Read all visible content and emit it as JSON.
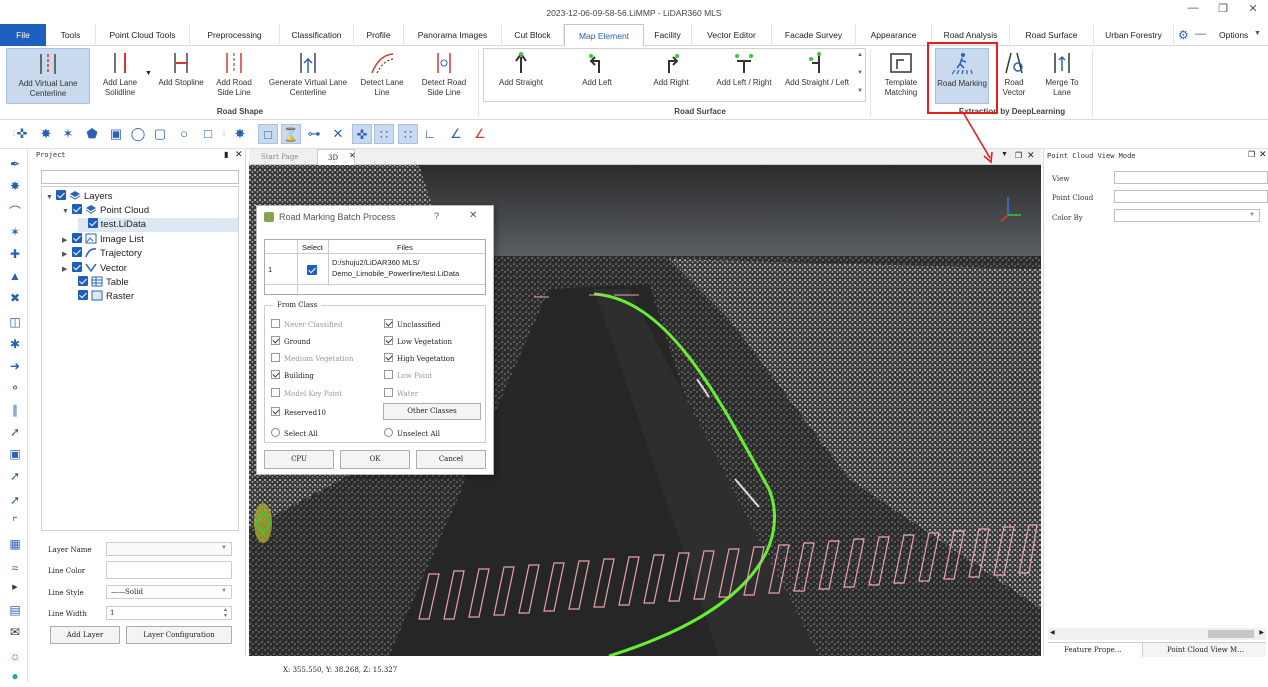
{
  "window": {
    "title": "2023-12-06-09-58-56.LiMMP - LiDAR360 MLS"
  },
  "menu": [
    "File",
    "Tools",
    "Point Cloud Tools",
    "Preprocessing",
    "Classification",
    "Profile",
    "Panorama Images",
    "Cut Block",
    "Map Element",
    "Facility",
    "Vector Editor",
    "Facade Survey",
    "Appearance",
    "Road Analysis",
    "Road Surface",
    "Urban Forestry"
  ],
  "menu_active": "Map Element",
  "options_label": "Options",
  "ribbon": {
    "road_shape": {
      "label": "Road Shape",
      "buttons": [
        "Add Virtual Lane Centerline",
        "Add Lane Solidline",
        "Add Stopline",
        "Add Road Side Line",
        "Generate Virtual Lane Centerline",
        "Detect Lane Line",
        "Detect Road Side Line"
      ]
    },
    "road_surface": {
      "label": "Road Surface",
      "buttons": [
        "Add Straight",
        "Add Left",
        "Add Right",
        "Add Left / Right",
        "Add Straight / Left"
      ]
    },
    "deeplearning": {
      "label": "Extraction by DeepLearning",
      "buttons": [
        "Template Matching",
        "Road Marking",
        "Road Vector",
        "Merge To Lane"
      ]
    }
  },
  "project_panel": {
    "title": "Project",
    "tree": [
      "Layers",
      "Point Cloud",
      "test.LiData",
      "Image List",
      "Trajectory",
      "Vector",
      "Table",
      "Raster"
    ],
    "props": {
      "layer_name_label": "Layer Name",
      "line_color_label": "Line Color",
      "line_style_label": "Line Style",
      "line_style_value": "Solid",
      "line_width_label": "Line Width",
      "line_width_value": "1"
    },
    "add_layer": "Add Layer",
    "layer_config": "Layer Configuration"
  },
  "view_tabs": [
    "Start Page",
    "3D"
  ],
  "right_panel": {
    "title": "Point Cloud View Mode",
    "labels": [
      "View",
      "Point Cloud",
      "Color By"
    ],
    "bottom_tabs": [
      "Feature Propе…",
      "Point Cloud View M…"
    ]
  },
  "dialog": {
    "title": "Road Marking Batch Process",
    "help": "?",
    "table_headers": [
      "Select",
      "Files"
    ],
    "rows": [
      {
        "index": "1",
        "file": "D:/shuju2/LiDAR360 MLS/ Demo_Limobile_Powerline/test.LiData"
      }
    ],
    "from_class": "From Class",
    "classes": [
      {
        "name": "Never Classified",
        "checked": false,
        "enabled": false
      },
      {
        "name": "Unclassified",
        "checked": true,
        "enabled": true
      },
      {
        "name": "Ground",
        "checked": true,
        "enabled": true
      },
      {
        "name": "Low Vegetation",
        "checked": true,
        "enabled": true
      },
      {
        "name": "Medium Vegetation",
        "checked": false,
        "enabled": false
      },
      {
        "name": "High Vegetation",
        "checked": true,
        "enabled": true
      },
      {
        "name": "Building",
        "checked": true,
        "enabled": true
      },
      {
        "name": "Low Point",
        "checked": false,
        "enabled": false
      },
      {
        "name": "Model Key Point",
        "checked": false,
        "enabled": false
      },
      {
        "name": "Water",
        "checked": false,
        "enabled": false
      },
      {
        "name": "Reserved10",
        "checked": true,
        "enabled": true
      }
    ],
    "other_classes": "Other Classes",
    "select_all": "Select All",
    "unselect_all": "Unselect All",
    "buttons": [
      "CPU",
      "OK",
      "Cancel"
    ]
  },
  "status": {
    "coords": "X: 355.550, Y: 38.268, Z: 15.327"
  },
  "colors": {
    "accent": "#1e5fbe",
    "highlight": "#e02020",
    "trajectory": "#66ee33",
    "crosswalk": "#e8a0b0"
  }
}
